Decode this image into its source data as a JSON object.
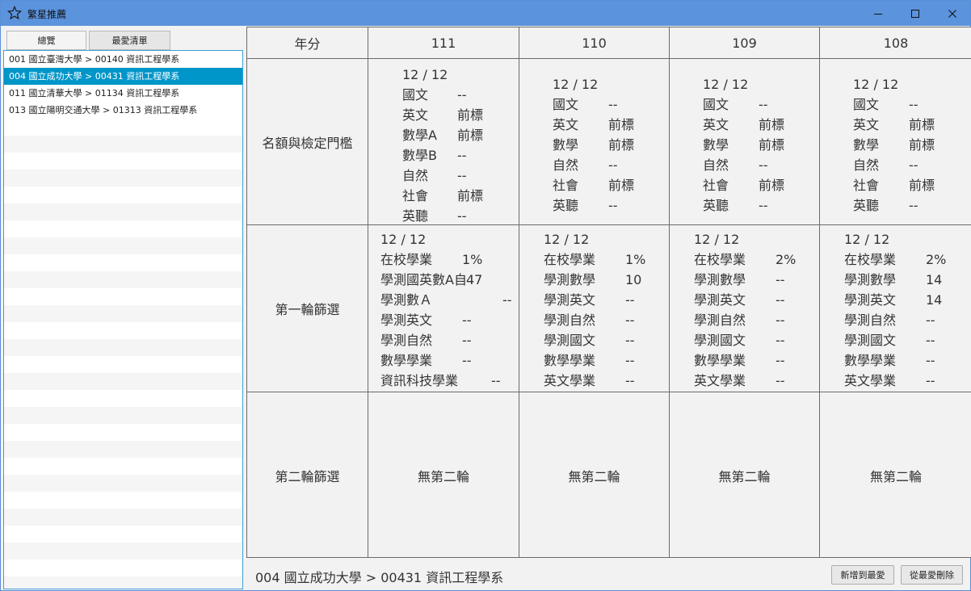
{
  "window": {
    "title": "繁星推薦"
  },
  "tabs": [
    {
      "label": "總覽"
    },
    {
      "label": "最愛清單"
    }
  ],
  "list": [
    "001 國立臺灣大學 > 00140 資訊工程學系",
    "004 國立成功大學 > 00431 資訊工程學系",
    "011 國立清華大學 > 01134 資訊工程學系",
    "013 國立陽明交通大學 > 01313 資訊工程學系"
  ],
  "selected_index": 1,
  "table": {
    "year_header": "年分",
    "years": [
      "111",
      "110",
      "109",
      "108"
    ],
    "row_labels": {
      "quota": "名額與檢定門檻",
      "first": "第一輪篩選",
      "second": "第二輪篩選"
    },
    "quota": [
      {
        "ratio": "12 / 12",
        "items": [
          [
            "國文",
            "--"
          ],
          [
            "英文",
            "前標"
          ],
          [
            "數學A",
            "前標"
          ],
          [
            "數學B",
            "--"
          ],
          [
            "自然",
            "--"
          ],
          [
            "社會",
            "前標"
          ],
          [
            "英聽",
            "--"
          ]
        ]
      },
      {
        "ratio": "12 / 12",
        "items": [
          [
            "國文",
            "--"
          ],
          [
            "英文",
            "前標"
          ],
          [
            "數學",
            "前標"
          ],
          [
            "自然",
            "--"
          ],
          [
            "社會",
            "前標"
          ],
          [
            "英聽",
            "--"
          ]
        ]
      },
      {
        "ratio": "12 / 12",
        "items": [
          [
            "國文",
            "--"
          ],
          [
            "英文",
            "前標"
          ],
          [
            "數學",
            "前標"
          ],
          [
            "自然",
            "--"
          ],
          [
            "社會",
            "前標"
          ],
          [
            "英聽",
            "--"
          ]
        ]
      },
      {
        "ratio": "12 / 12",
        "items": [
          [
            "國文",
            "--"
          ],
          [
            "英文",
            "前標"
          ],
          [
            "數學",
            "前標"
          ],
          [
            "自然",
            "--"
          ],
          [
            "社會",
            "前標"
          ],
          [
            "英聽",
            "--"
          ]
        ]
      }
    ],
    "first": [
      {
        "ratio": "12 / 12",
        "items": [
          [
            "在校學業",
            "1%"
          ],
          [
            "學測國英數A自",
            "47"
          ],
          [
            "學測數Ａ",
            "--"
          ],
          [
            "學測英文",
            "--"
          ],
          [
            "學測自然",
            "--"
          ],
          [
            "數學學業",
            "--"
          ],
          [
            "資訊科技學業",
            "--"
          ]
        ]
      },
      {
        "ratio": "12 / 12",
        "items": [
          [
            "在校學業",
            "1%"
          ],
          [
            "學測數學",
            "10"
          ],
          [
            "學測英文",
            "--"
          ],
          [
            "學測自然",
            "--"
          ],
          [
            "學測國文",
            "--"
          ],
          [
            "數學學業",
            "--"
          ],
          [
            "英文學業",
            "--"
          ]
        ]
      },
      {
        "ratio": "12 / 12",
        "items": [
          [
            "在校學業",
            "2%"
          ],
          [
            "學測數學",
            "--"
          ],
          [
            "學測英文",
            "--"
          ],
          [
            "學測自然",
            "--"
          ],
          [
            "學測國文",
            "--"
          ],
          [
            "數學學業",
            "--"
          ],
          [
            "英文學業",
            "--"
          ]
        ]
      },
      {
        "ratio": "12 / 12",
        "items": [
          [
            "在校學業",
            "2%"
          ],
          [
            "學測數學",
            "14"
          ],
          [
            "學測英文",
            "14"
          ],
          [
            "學測自然",
            "--"
          ],
          [
            "學測國文",
            "--"
          ],
          [
            "數學學業",
            "--"
          ],
          [
            "英文學業",
            "--"
          ]
        ]
      }
    ],
    "second": [
      "無第二輪",
      "無第二輪",
      "無第二輪",
      "無第二輪"
    ]
  },
  "footer": {
    "current": "004 國立成功大學 > 00431 資訊工程學系",
    "add_button": "新增到最愛",
    "remove_button": "從最愛刪除"
  }
}
